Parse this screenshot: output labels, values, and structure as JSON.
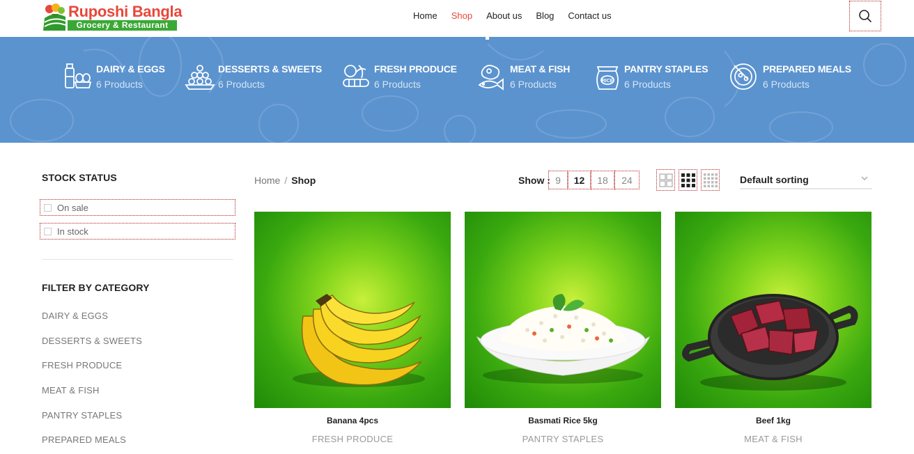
{
  "brand": {
    "title": "Ruposhi Bangla",
    "tagline": "Grocery & Restaurant"
  },
  "nav": [
    {
      "label": "Home",
      "active": false
    },
    {
      "label": "Shop",
      "active": true
    },
    {
      "label": "About us",
      "active": false
    },
    {
      "label": "Blog",
      "active": false
    },
    {
      "label": "Contact us",
      "active": false
    }
  ],
  "banner_categories": [
    {
      "name": "DAIRY & EGGS",
      "count": "6 Products",
      "icon": "milk-eggs-icon"
    },
    {
      "name": "DESSERTS & SWEETS",
      "count": "6 Products",
      "icon": "sweets-plate-icon"
    },
    {
      "name": "FRESH PRODUCE",
      "count": "6 Products",
      "icon": "vegetables-icon"
    },
    {
      "name": "MEAT & FISH",
      "count": "6 Products",
      "icon": "meat-fish-icon"
    },
    {
      "name": "PANTRY STAPLES",
      "count": "6 Products",
      "icon": "rice-bag-icon"
    },
    {
      "name": "PREPARED MEALS",
      "count": "6 Products",
      "icon": "meal-bowl-icon"
    }
  ],
  "sidebar": {
    "stock_heading": "STOCK STATUS",
    "stock_options": [
      "On sale",
      "In stock"
    ],
    "category_heading": "FILTER BY CATEGORY",
    "categories": [
      "DAIRY & EGGS",
      "DESSERTS & SWEETS",
      "FRESH PRODUCE",
      "MEAT & FISH",
      "PANTRY STAPLES",
      "PREPARED MEALS"
    ]
  },
  "breadcrumb": {
    "home": "Home",
    "separator": "/",
    "current": "Shop"
  },
  "toolbar": {
    "show_label": "Show :",
    "per_page": [
      "9",
      "12",
      "18",
      "24"
    ],
    "per_page_active": "12",
    "per_page_separator": "/",
    "sort_label": "Default sorting"
  },
  "products": [
    {
      "name": "Banana 4pcs",
      "category": "FRESH PRODUCE"
    },
    {
      "name": "Basmati Rice 5kg",
      "category": "PANTRY STAPLES"
    },
    {
      "name": "Beef 1kg",
      "category": "MEAT & FISH"
    }
  ],
  "colors": {
    "accent": "#e8473a",
    "banner": "#5b93cf",
    "brand_green": "#3aa835"
  }
}
